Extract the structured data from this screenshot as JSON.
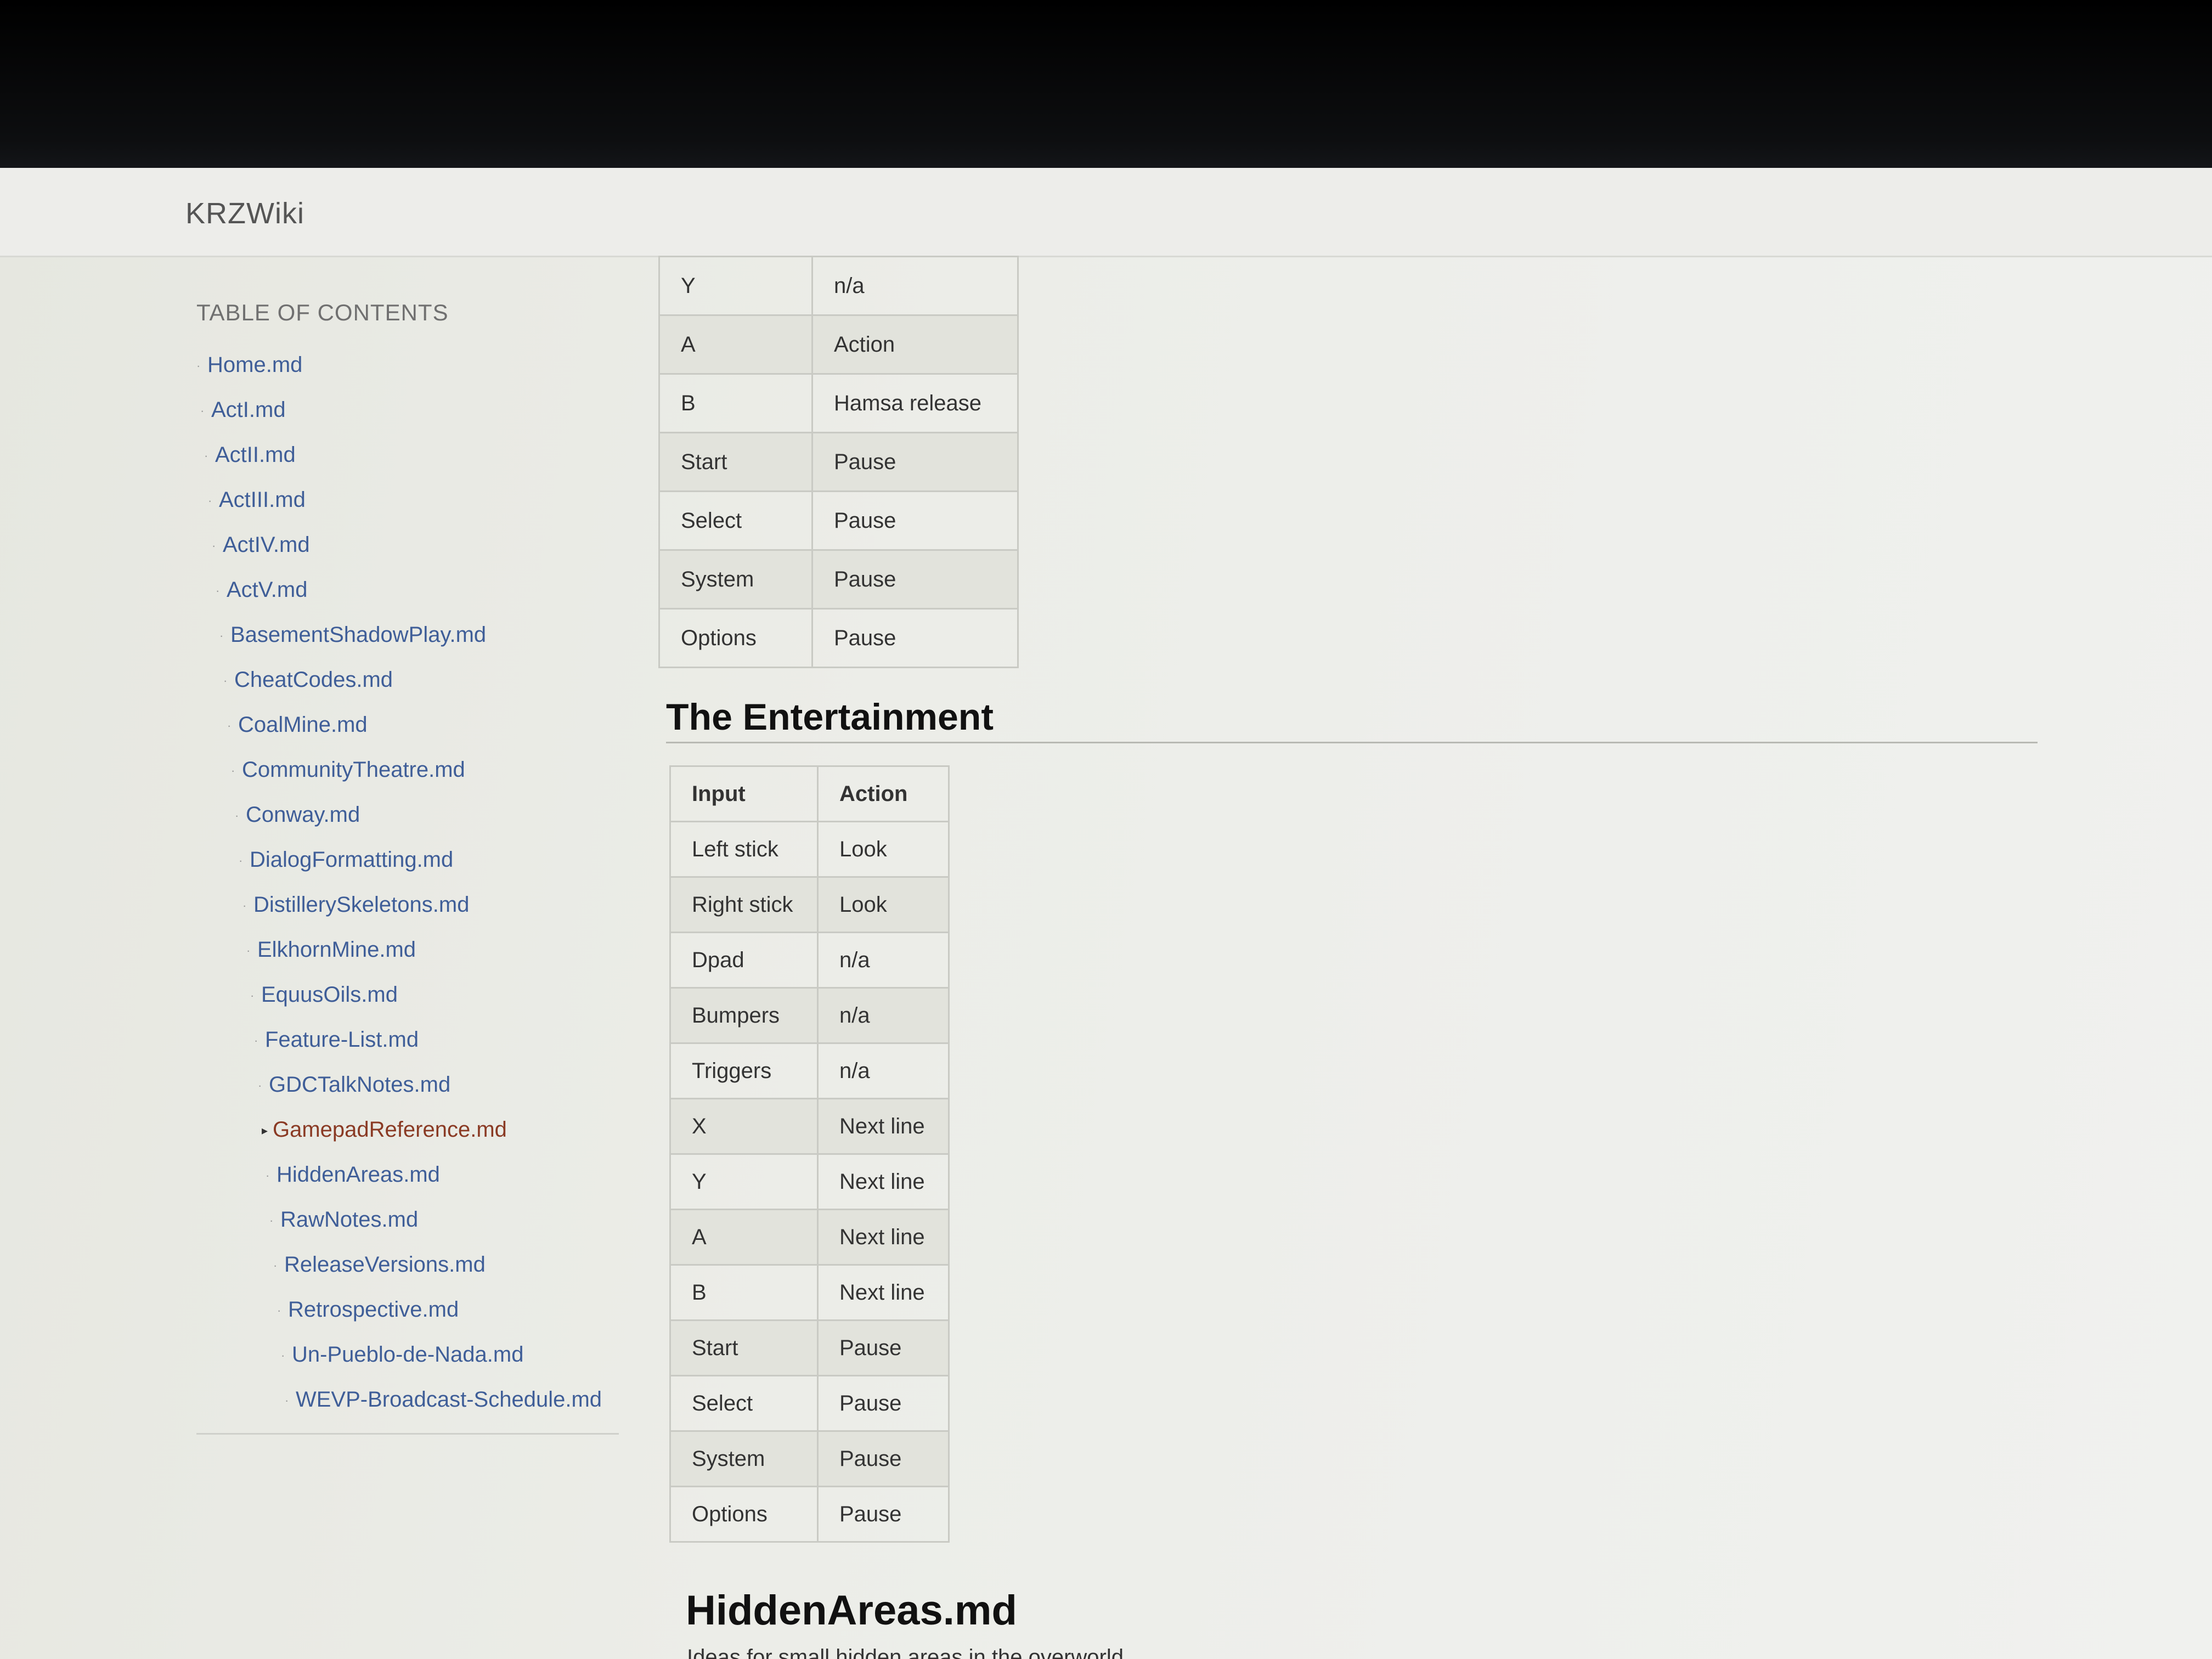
{
  "navbar": {
    "brand": "KRZWiki"
  },
  "sidebar": {
    "title": "TABLE OF CONTENTS",
    "items": [
      {
        "label": "Home.md"
      },
      {
        "label": "ActI.md"
      },
      {
        "label": "ActII.md"
      },
      {
        "label": "ActIII.md"
      },
      {
        "label": "ActIV.md"
      },
      {
        "label": "ActV.md"
      },
      {
        "label": "BasementShadowPlay.md"
      },
      {
        "label": "CheatCodes.md"
      },
      {
        "label": "CoalMine.md"
      },
      {
        "label": "CommunityTheatre.md"
      },
      {
        "label": "Conway.md"
      },
      {
        "label": "DialogFormatting.md"
      },
      {
        "label": "DistillerySkeletons.md"
      },
      {
        "label": "ElkhornMine.md"
      },
      {
        "label": "EquusOils.md"
      },
      {
        "label": "Feature-List.md"
      },
      {
        "label": "GDCTalkNotes.md"
      },
      {
        "label": "GamepadReference.md"
      },
      {
        "label": "HiddenAreas.md"
      },
      {
        "label": "RawNotes.md"
      },
      {
        "label": "ReleaseVersions.md"
      },
      {
        "label": "Retrospective.md"
      },
      {
        "label": "Un-Pueblo-de-Nada.md"
      },
      {
        "label": "WEVP-Broadcast-Schedule.md"
      }
    ],
    "active": "GamepadReference.md",
    "active_bullet": "▸",
    "bullet": "·"
  },
  "table1": {
    "rows": [
      [
        "Y",
        "n/a"
      ],
      [
        "A",
        "Action"
      ],
      [
        "B",
        "Hamsa release"
      ],
      [
        "Start",
        "Pause"
      ],
      [
        "Select",
        "Pause"
      ],
      [
        "System",
        "Pause"
      ],
      [
        "Options",
        "Pause"
      ]
    ]
  },
  "section2": {
    "heading": "The Entertainment",
    "headers": [
      "Input",
      "Action"
    ],
    "rows": [
      [
        "Left stick",
        "Look"
      ],
      [
        "Right stick",
        "Look"
      ],
      [
        "Dpad",
        "n/a"
      ],
      [
        "Bumpers",
        "n/a"
      ],
      [
        "Triggers",
        "n/a"
      ],
      [
        "X",
        "Next line"
      ],
      [
        "Y",
        "Next line"
      ],
      [
        "A",
        "Next line"
      ],
      [
        "B",
        "Next line"
      ],
      [
        "Start",
        "Pause"
      ],
      [
        "Select",
        "Pause"
      ],
      [
        "System",
        "Pause"
      ],
      [
        "Options",
        "Pause"
      ]
    ]
  },
  "next_page": {
    "heading": "HiddenAreas.md",
    "intro": "Ideas for small hidden areas in the overworld"
  },
  "colors": {
    "link": "#3f5e98",
    "active_link": "#8a3a24"
  }
}
